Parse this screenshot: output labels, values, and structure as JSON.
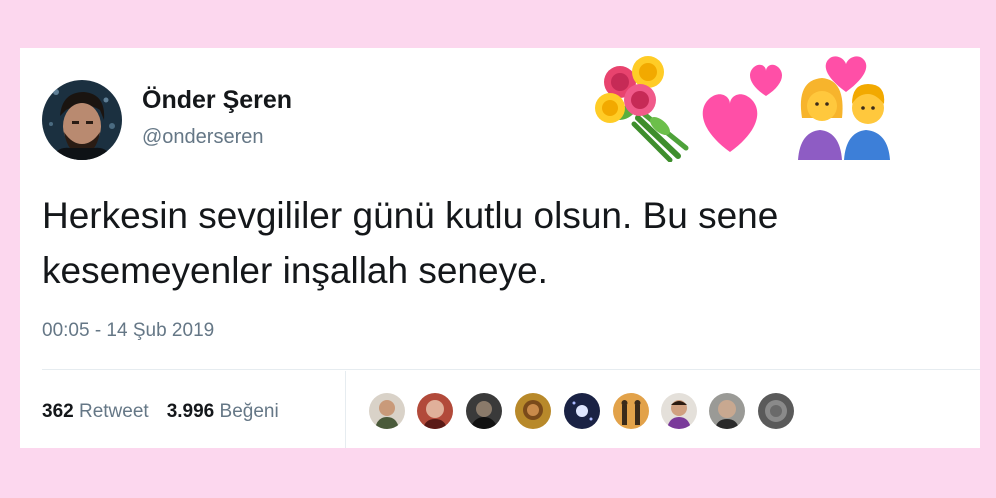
{
  "tweet": {
    "author_name": "Önder Şeren",
    "author_handle": "@onderseren",
    "text": "Herkesin sevgililer günü kutlu olsun. Bu sene kesemeyenler inşallah seneye.",
    "timestamp": "00:05 - 14 Şub 2019",
    "retweet_count": "362",
    "retweet_label": "Retweet",
    "like_count": "3.996",
    "like_label": "Beğeni"
  },
  "icons": [
    "bouquet-icon",
    "two-hearts-icon",
    "couple-with-heart-icon"
  ],
  "colors": {
    "page_background": "#fcd7ee",
    "card_background": "#ffffff",
    "text_primary": "#14171a",
    "text_secondary": "#657786",
    "divider": "#e6ecf0"
  }
}
